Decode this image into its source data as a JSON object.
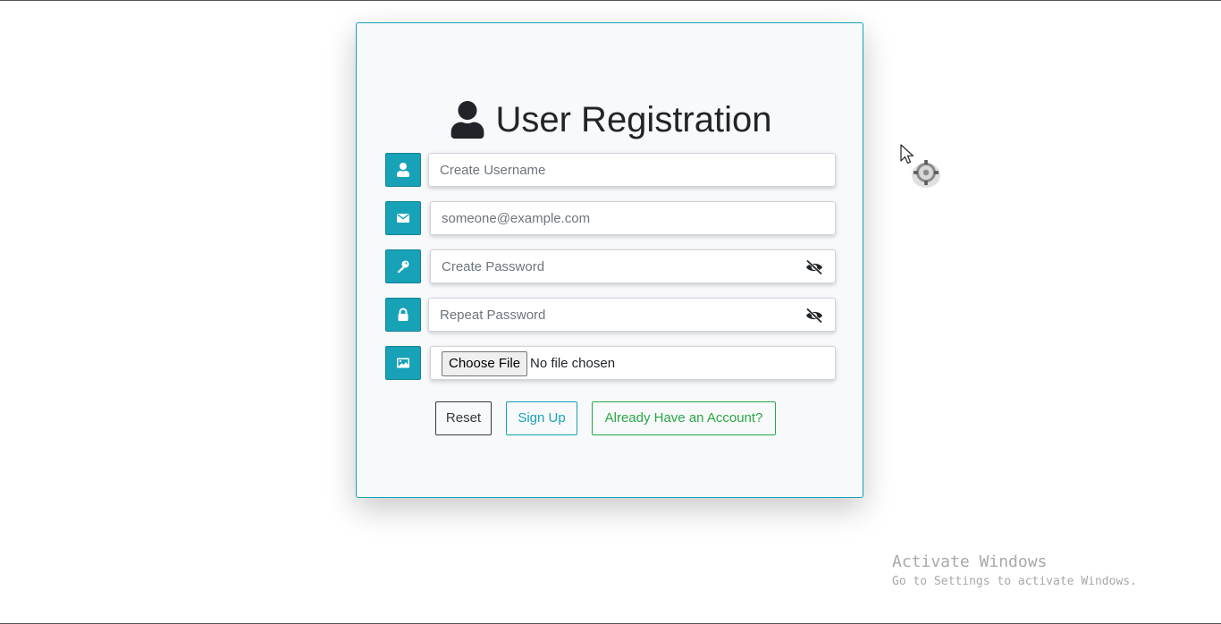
{
  "form": {
    "title": "User Registration",
    "title_icon": "user-icon",
    "fields": [
      {
        "icon": "user-icon",
        "placeholder": "Create Username",
        "value": ""
      },
      {
        "icon": "envelope-icon",
        "placeholder": "someone@example.com",
        "value": ""
      },
      {
        "icon": "key-icon",
        "placeholder": "Create Password",
        "value": "",
        "toggle_icon": "eye-slash-icon"
      },
      {
        "icon": "lock-icon",
        "placeholder": "Repeat Password",
        "value": "",
        "toggle_icon": "eye-slash-icon"
      },
      {
        "icon": "image-icon",
        "file_button": "Choose File",
        "file_status": "No file chosen"
      }
    ],
    "buttons": {
      "reset": "Reset",
      "signup": "Sign Up",
      "login": "Already Have an Account?"
    }
  },
  "watermark": {
    "title": "Activate Windows",
    "subtitle": "Go to Settings to activate Windows."
  },
  "colors": {
    "accent": "#17a2b8",
    "success": "#28a745",
    "dark": "#343a40",
    "card_background": "#f8f9fa"
  }
}
